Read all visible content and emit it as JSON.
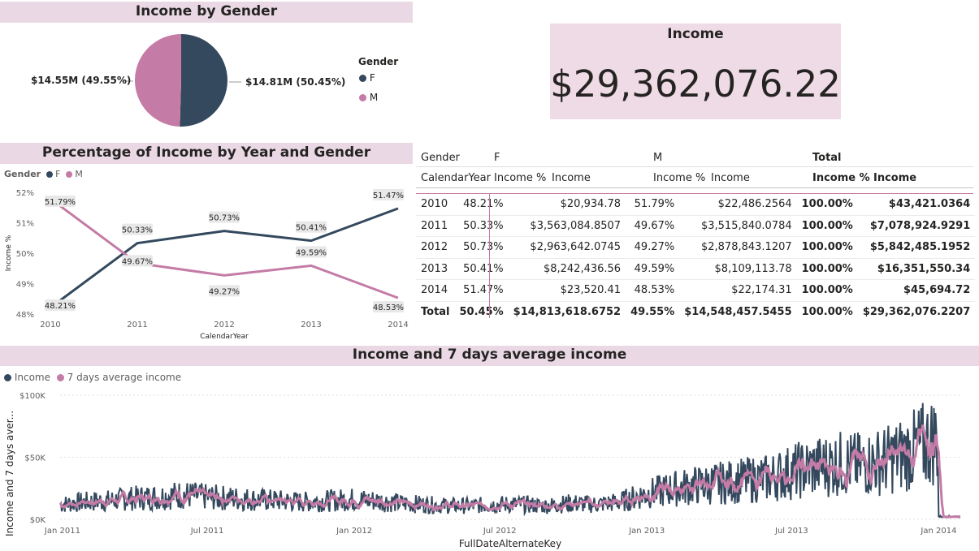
{
  "colors": {
    "f": "#34495e",
    "m": "#c47ba6",
    "band": "#ead9e5",
    "card": "#efdbe5"
  },
  "pie": {
    "title": "Income by Gender",
    "legend_title": "Gender",
    "legend": [
      "F",
      "M"
    ],
    "labels": {
      "f": "$14.81M (50.45%)",
      "m": "$14.55M (49.55%)"
    }
  },
  "card": {
    "title": "Income",
    "value": "$29,362,076.22"
  },
  "line_chart": {
    "title": "Percentage of Income by Year and Gender",
    "legend_title": "Gender",
    "legend": [
      "F",
      "M"
    ]
  },
  "matrix": {
    "header1": [
      "Gender",
      "F",
      "M",
      "Total"
    ],
    "header2": [
      "CalendarYear",
      "Income %",
      "Income",
      "Income %",
      "Income",
      "Income %",
      "Income"
    ],
    "rows": [
      [
        "2010",
        "48.21%",
        "$20,934.78",
        "51.79%",
        "$22,486.2564",
        "100.00%",
        "$43,421.0364"
      ],
      [
        "2011",
        "50.33%",
        "$3,563,084.8507",
        "49.67%",
        "$3,515,840.0784",
        "100.00%",
        "$7,078,924.9291"
      ],
      [
        "2012",
        "50.73%",
        "$2,963,642.0745",
        "49.27%",
        "$2,878,843.1207",
        "100.00%",
        "$5,842,485.1952"
      ],
      [
        "2013",
        "50.41%",
        "$8,242,436.56",
        "49.59%",
        "$8,109,113.78",
        "100.00%",
        "$16,351,550.34"
      ],
      [
        "2014",
        "51.47%",
        "$23,520.41",
        "48.53%",
        "$22,174.31",
        "100.00%",
        "$45,694.72"
      ]
    ],
    "total": [
      "Total",
      "50.45%",
      "$14,813,618.6752",
      "49.55%",
      "$14,548,457.5455",
      "100.00%",
      "$29,362,076.2207"
    ]
  },
  "ts_chart": {
    "title": "Income and 7 days average income",
    "legend": [
      "Income",
      "7 days average income"
    ]
  },
  "chart_data": [
    {
      "type": "pie",
      "title": "Income by Gender",
      "legend_title": "Gender",
      "categories": [
        "F",
        "M"
      ],
      "values": [
        14813618.6752,
        14548457.5455
      ],
      "data_labels": [
        "$14.81M (50.45%)",
        "$14.55M (49.55%)"
      ]
    },
    {
      "type": "line",
      "title": "Percentage of Income by Year and Gender",
      "xlabel": "CalendarYear",
      "ylabel": "Income %",
      "legend_title": "Gender",
      "legend_position": "top-left",
      "categories": [
        "2010",
        "2011",
        "2012",
        "2013",
        "2014"
      ],
      "yticks": [
        "48%",
        "49%",
        "50%",
        "51%",
        "52%"
      ],
      "ylim": [
        48,
        52
      ],
      "series": [
        {
          "name": "F",
          "values": [
            48.21,
            50.33,
            50.73,
            50.41,
            51.47
          ],
          "labels": [
            "48.21%",
            "50.33%",
            "50.73%",
            "50.41%",
            "51.47%"
          ]
        },
        {
          "name": "M",
          "values": [
            51.79,
            49.67,
            49.27,
            49.59,
            48.53
          ],
          "labels": [
            "51.79%",
            "49.67%",
            "49.27%",
            "49.59%",
            "48.53%"
          ]
        }
      ]
    },
    {
      "type": "line",
      "title": "Income and 7 days average income",
      "xlabel": "FullDateAlternateKey",
      "ylabel": "Income and 7 days aver...",
      "legend_position": "top-left",
      "xticks": [
        "Jan 2011",
        "Jul 2011",
        "Jan 2012",
        "Jul 2012",
        "Jan 2013",
        "Jul 2013",
        "Jan 2014"
      ],
      "yticks": [
        "$0K",
        "$50K",
        "$100K"
      ],
      "ylim": [
        0,
        100000
      ],
      "x_range": [
        "2010-12-29",
        "2014-01-28"
      ],
      "series": [
        {
          "name": "Income",
          "note": "daily values; approx level",
          "monthly_avg": [
            12000,
            14000,
            15000,
            17000,
            18000,
            20000,
            18000,
            17000,
            16000,
            15000,
            14000,
            15000,
            16000,
            15000,
            13000,
            12000,
            11000,
            11000,
            12000,
            12000,
            11000,
            13000,
            12000,
            14000,
            20000,
            24000,
            27000,
            29000,
            31000,
            33000,
            38000,
            42000,
            45000,
            44000,
            48000,
            55000,
            65000,
            2000
          ]
        },
        {
          "name": "7 days average income",
          "monthly_avg": [
            12000,
            14000,
            15000,
            17000,
            18000,
            20000,
            18000,
            17000,
            16000,
            15000,
            14000,
            15000,
            16000,
            15000,
            13000,
            12000,
            11000,
            11000,
            12000,
            12000,
            11000,
            13000,
            12000,
            14000,
            20000,
            24000,
            27000,
            29000,
            31000,
            33000,
            38000,
            42000,
            45000,
            44000,
            48000,
            55000,
            65000,
            2000
          ]
        }
      ]
    }
  ]
}
